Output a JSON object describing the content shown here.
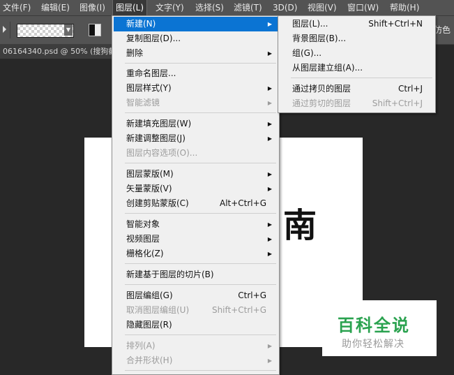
{
  "menubar": {
    "items": [
      {
        "label": "文件(F)"
      },
      {
        "label": "编辑(E)"
      },
      {
        "label": "图像(I)"
      },
      {
        "label": "图层(L)"
      },
      {
        "label": "文字(Y)"
      },
      {
        "label": "选择(S)"
      },
      {
        "label": "滤镜(T)"
      },
      {
        "label": "3D(D)"
      },
      {
        "label": "视图(V)"
      },
      {
        "label": "窗口(W)"
      },
      {
        "label": "帮助(H)"
      }
    ]
  },
  "options_bar": {
    "dither_label": "仿色"
  },
  "document": {
    "tab_title": "06164340.psd @ 50% (搜狗截",
    "canvas_glyph": "南"
  },
  "layer_menu": {
    "items": [
      {
        "label": "新建(N)",
        "shortcut": "",
        "submenu": true,
        "enabled": true,
        "highlighted": true
      },
      {
        "label": "复制图层(D)...",
        "shortcut": "",
        "submenu": false,
        "enabled": true
      },
      {
        "label": "删除",
        "shortcut": "",
        "submenu": true,
        "enabled": true
      },
      {
        "label": "重命名图层...",
        "shortcut": "",
        "submenu": false,
        "enabled": true
      },
      {
        "label": "图层样式(Y)",
        "shortcut": "",
        "submenu": true,
        "enabled": true
      },
      {
        "label": "智能滤镜",
        "shortcut": "",
        "submenu": true,
        "enabled": false
      },
      {
        "label": "新建填充图层(W)",
        "shortcut": "",
        "submenu": true,
        "enabled": true
      },
      {
        "label": "新建调整图层(J)",
        "shortcut": "",
        "submenu": true,
        "enabled": true
      },
      {
        "label": "图层内容选项(O)...",
        "shortcut": "",
        "submenu": false,
        "enabled": false
      },
      {
        "label": "图层蒙版(M)",
        "shortcut": "",
        "submenu": true,
        "enabled": true
      },
      {
        "label": "矢量蒙版(V)",
        "shortcut": "",
        "submenu": true,
        "enabled": true
      },
      {
        "label": "创建剪贴蒙版(C)",
        "shortcut": "Alt+Ctrl+G",
        "submenu": false,
        "enabled": true
      },
      {
        "label": "智能对象",
        "shortcut": "",
        "submenu": true,
        "enabled": true
      },
      {
        "label": "视频图层",
        "shortcut": "",
        "submenu": true,
        "enabled": true
      },
      {
        "label": "栅格化(Z)",
        "shortcut": "",
        "submenu": true,
        "enabled": true
      },
      {
        "label": "新建基于图层的切片(B)",
        "shortcut": "",
        "submenu": false,
        "enabled": true
      },
      {
        "label": "图层编组(G)",
        "shortcut": "Ctrl+G",
        "submenu": false,
        "enabled": true
      },
      {
        "label": "取消图层编组(U)",
        "shortcut": "Shift+Ctrl+G",
        "submenu": false,
        "enabled": false
      },
      {
        "label": "隐藏图层(R)",
        "shortcut": "",
        "submenu": false,
        "enabled": true
      },
      {
        "label": "排列(A)",
        "shortcut": "",
        "submenu": true,
        "enabled": false
      },
      {
        "label": "合并形状(H)",
        "shortcut": "",
        "submenu": true,
        "enabled": false
      }
    ]
  },
  "new_submenu": {
    "items": [
      {
        "label": "图层(L)...",
        "shortcut": "Shift+Ctrl+N",
        "enabled": true
      },
      {
        "label": "背景图层(B)...",
        "shortcut": "",
        "enabled": true
      },
      {
        "label": "组(G)...",
        "shortcut": "",
        "enabled": true
      },
      {
        "label": "从图层建立组(A)...",
        "shortcut": "",
        "enabled": true
      },
      {
        "label": "通过拷贝的图层",
        "shortcut": "Ctrl+J",
        "enabled": true
      },
      {
        "label": "通过剪切的图层",
        "shortcut": "Shift+Ctrl+J",
        "enabled": false
      }
    ]
  },
  "watermark": {
    "title": "百科全说",
    "subtitle": "助你轻松解决"
  },
  "colors": {
    "menu_highlight": "#0b74d3",
    "watermark_green": "#2aa24f"
  }
}
